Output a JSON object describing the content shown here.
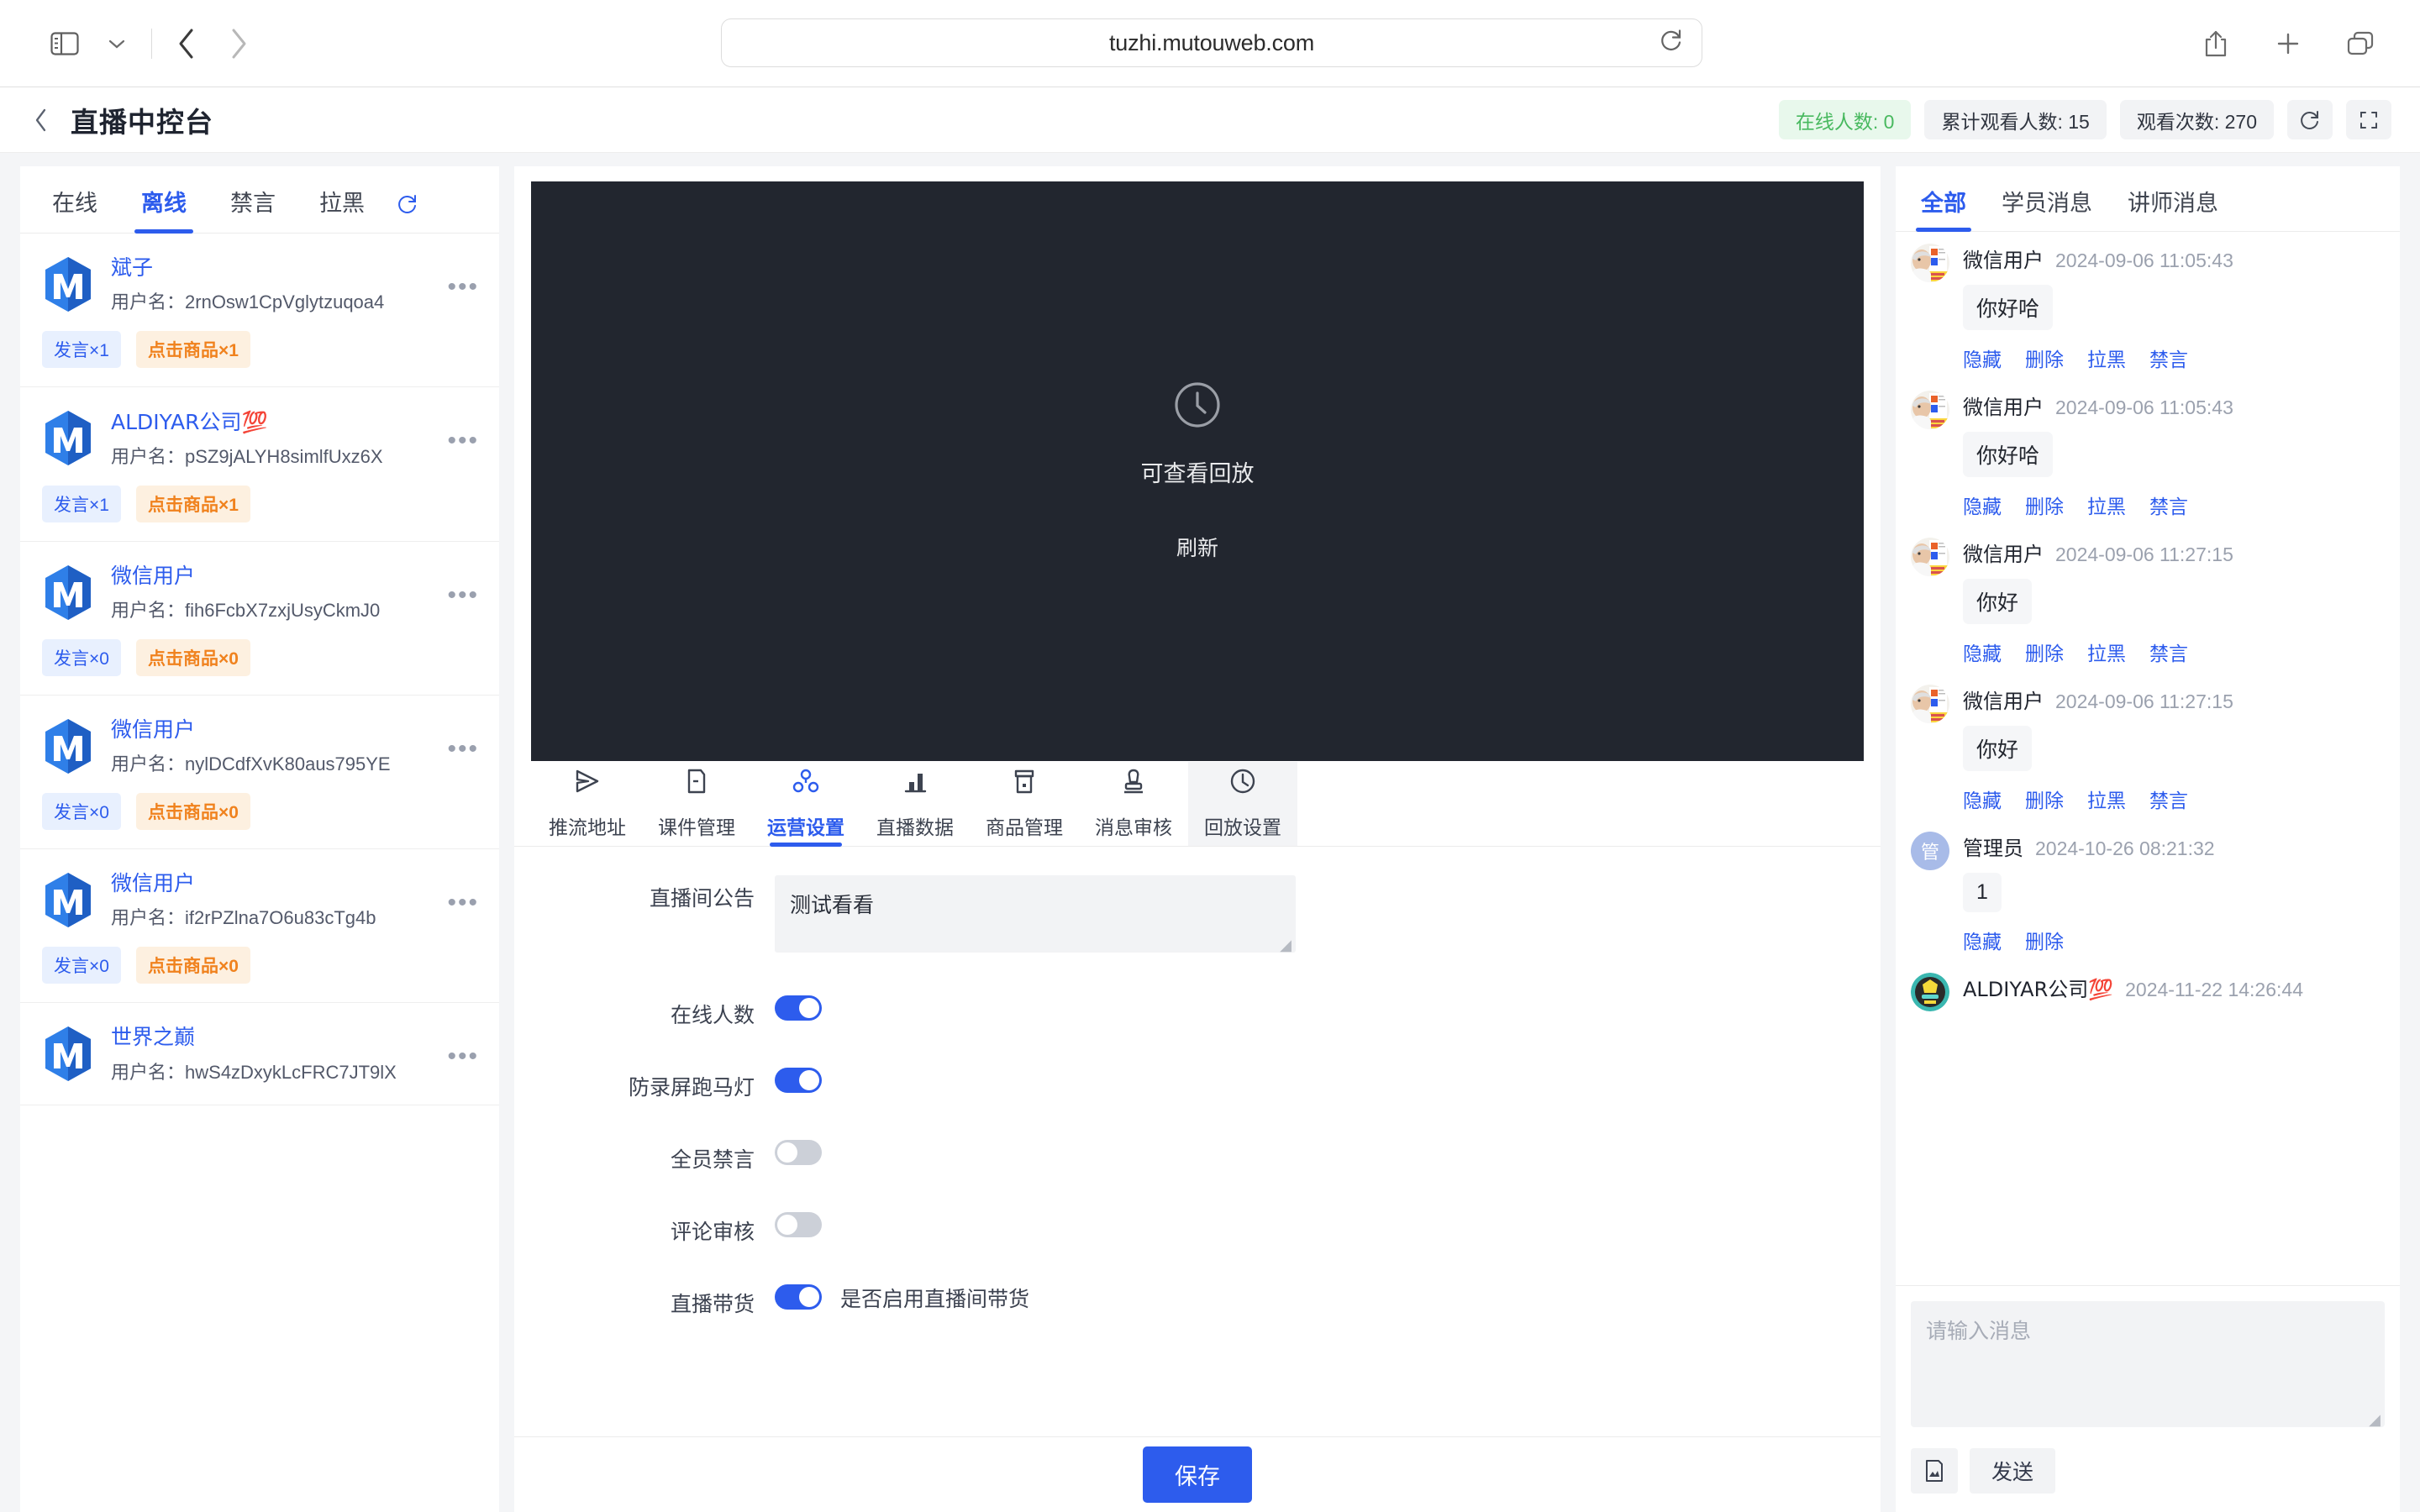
{
  "browser": {
    "url": "tuzhi.mutouweb.com",
    "icons": {
      "sidebar": "sidebar-icon",
      "tab_dropdown": "chevron-down-icon",
      "back": "chevron-left-icon",
      "forward": "chevron-right-icon",
      "reload": "reload-icon",
      "share": "share-icon",
      "new_tab": "plus-icon",
      "tab_overview": "tab-overview-icon"
    }
  },
  "header": {
    "back_icon": "chevron-left-icon",
    "title": "直播中控台",
    "stats": [
      {
        "label": "在线人数: 0",
        "style": "green"
      },
      {
        "label": "累计观看人数: 15",
        "style": "grey"
      },
      {
        "label": "观看次数: 270",
        "style": "grey"
      }
    ],
    "refresh_icon": "reload-icon",
    "fullscreen_icon": "fullscreen-icon"
  },
  "left_panel": {
    "tabs": [
      {
        "label": "在线",
        "active": false
      },
      {
        "label": "离线",
        "active": true
      },
      {
        "label": "禁言",
        "active": false
      },
      {
        "label": "拉黑",
        "active": false
      }
    ],
    "refresh_icon": "reload-icon",
    "username_label": "用户名：",
    "more_icon": "ellipsis-icon",
    "users": [
      {
        "nickname": "斌子",
        "username": "2rnOsw1CpVglytzuqoa4",
        "tags": [
          {
            "text": "发言×1",
            "style": "blue"
          },
          {
            "text": "点击商品×1",
            "style": "orange"
          }
        ]
      },
      {
        "nickname": "ALDIYAR公司💯",
        "username": "pSZ9jALYH8simlfUxz6X",
        "tags": [
          {
            "text": "发言×1",
            "style": "blue"
          },
          {
            "text": "点击商品×1",
            "style": "orange"
          }
        ]
      },
      {
        "nickname": "微信用户",
        "username": "fih6FcbX7zxjUsyCkmJ0",
        "tags": [
          {
            "text": "发言×0",
            "style": "blue"
          },
          {
            "text": "点击商品×0",
            "style": "orange"
          }
        ]
      },
      {
        "nickname": "微信用户",
        "username": "nylDCdfXvK80aus795YE",
        "tags": [
          {
            "text": "发言×0",
            "style": "blue"
          },
          {
            "text": "点击商品×0",
            "style": "orange"
          }
        ]
      },
      {
        "nickname": "微信用户",
        "username": "if2rPZlna7O6u83cTg4b",
        "tags": [
          {
            "text": "发言×0",
            "style": "blue"
          },
          {
            "text": "点击商品×0",
            "style": "orange"
          }
        ]
      },
      {
        "nickname": "世界之巅",
        "username": "hwS4zDxykLcFRC7JT9lX",
        "tags": []
      }
    ]
  },
  "center_panel": {
    "video": {
      "icon": "clock-icon",
      "message": "可查看回放",
      "refresh_label": "刷新"
    },
    "tabs": [
      {
        "label": "推流地址",
        "icon": "send-icon",
        "active": false,
        "hover": false
      },
      {
        "label": "课件管理",
        "icon": "document-icon",
        "active": false,
        "hover": false
      },
      {
        "label": "运营设置",
        "icon": "settings-nodes-icon",
        "active": true,
        "hover": false
      },
      {
        "label": "直播数据",
        "icon": "bar-chart-icon",
        "active": false,
        "hover": false
      },
      {
        "label": "商品管理",
        "icon": "product-box-icon",
        "active": false,
        "hover": false
      },
      {
        "label": "消息审核",
        "icon": "stamp-icon",
        "active": false,
        "hover": false
      },
      {
        "label": "回放设置",
        "icon": "clock-icon",
        "active": false,
        "hover": true
      }
    ],
    "form": {
      "announcement": {
        "label": "直播间公告",
        "value": "测试看看"
      },
      "toggles": [
        {
          "label": "在线人数",
          "on": true,
          "hint": ""
        },
        {
          "label": "防录屏跑马灯",
          "on": true,
          "hint": ""
        },
        {
          "label": "全员禁言",
          "on": false,
          "hint": ""
        },
        {
          "label": "评论审核",
          "on": false,
          "hint": ""
        },
        {
          "label": "直播带货",
          "on": true,
          "hint": "是否启用直播间带货"
        }
      ],
      "save_label": "保存"
    }
  },
  "right_panel": {
    "tabs": [
      {
        "label": "全部",
        "active": true
      },
      {
        "label": "学员消息",
        "active": false
      },
      {
        "label": "讲师消息",
        "active": false
      }
    ],
    "messages": [
      {
        "avatar": "photo",
        "name": "微信用户",
        "time": "2024-09-06 11:05:43",
        "text": "你好哈",
        "actions": [
          "隐藏",
          "删除",
          "拉黑",
          "禁言"
        ]
      },
      {
        "avatar": "photo",
        "name": "微信用户",
        "time": "2024-09-06 11:05:43",
        "text": "你好哈",
        "actions": [
          "隐藏",
          "删除",
          "拉黑",
          "禁言"
        ]
      },
      {
        "avatar": "photo",
        "name": "微信用户",
        "time": "2024-09-06 11:27:15",
        "text": "你好",
        "actions": [
          "隐藏",
          "删除",
          "拉黑",
          "禁言"
        ]
      },
      {
        "avatar": "photo",
        "name": "微信用户",
        "time": "2024-09-06 11:27:15",
        "text": "你好",
        "actions": [
          "隐藏",
          "删除",
          "拉黑",
          "禁言"
        ]
      },
      {
        "avatar": "admin",
        "avatar_text": "管",
        "name": "管理员",
        "time": "2024-10-26 08:21:32",
        "text": "1",
        "actions": [
          "隐藏",
          "删除"
        ]
      },
      {
        "avatar": "photo2",
        "name": "ALDIYAR公司💯",
        "time": "2024-11-22 14:26:44",
        "text": "",
        "actions": []
      }
    ],
    "compose": {
      "placeholder": "请输入消息",
      "image_icon": "image-icon",
      "send_label": "发送"
    }
  },
  "colors": {
    "accent": "#2d5ced",
    "green": "#48b95f",
    "orange": "#f0821e",
    "video_bg": "#22262f"
  }
}
